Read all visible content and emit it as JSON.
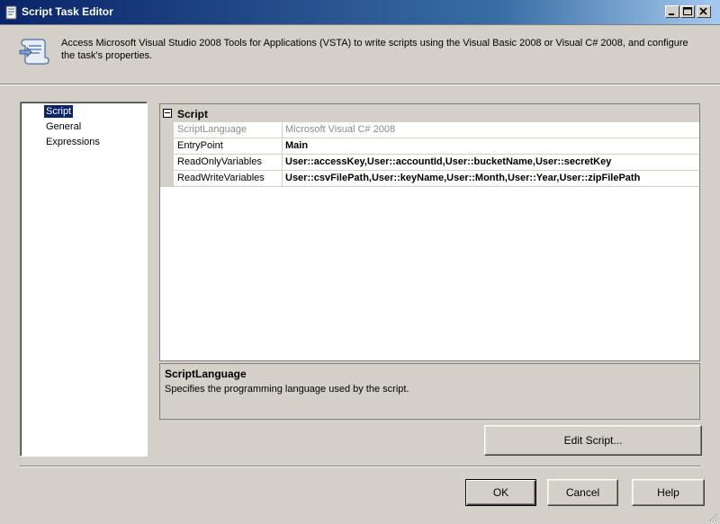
{
  "window": {
    "title": "Script Task Editor"
  },
  "header": {
    "description": "Access Microsoft Visual Studio 2008 Tools for Applications (VSTA) to write scripts using the Visual Basic 2008 or Visual C# 2008, and configure the task's properties.",
    "icon": "script-scroll-icon"
  },
  "nav": {
    "items": [
      {
        "label": "Script",
        "selected": true
      },
      {
        "label": "General",
        "selected": false
      },
      {
        "label": "Expressions",
        "selected": false
      }
    ]
  },
  "grid": {
    "category": "Script",
    "properties": [
      {
        "name": "ScriptLanguage",
        "value": "Microsoft Visual C# 2008",
        "readonly": true
      },
      {
        "name": "EntryPoint",
        "value": "Main",
        "readonly": false
      },
      {
        "name": "ReadOnlyVariables",
        "value": "User::accessKey,User::accountId,User::bucketName,User::secretKey",
        "readonly": false
      },
      {
        "name": "ReadWriteVariables",
        "value": "User::csvFilePath,User::keyName,User::Month,User::Year,User::zipFilePath",
        "readonly": false
      }
    ]
  },
  "description_panel": {
    "title": "ScriptLanguage",
    "text": "Specifies the programming language used by the script."
  },
  "buttons": {
    "edit_script": "Edit Script...",
    "ok": "OK",
    "cancel": "Cancel",
    "help": "Help"
  },
  "colors": {
    "title_bar": "#0a246a",
    "selection": "#0a246a",
    "face": "#d4d0c8"
  }
}
